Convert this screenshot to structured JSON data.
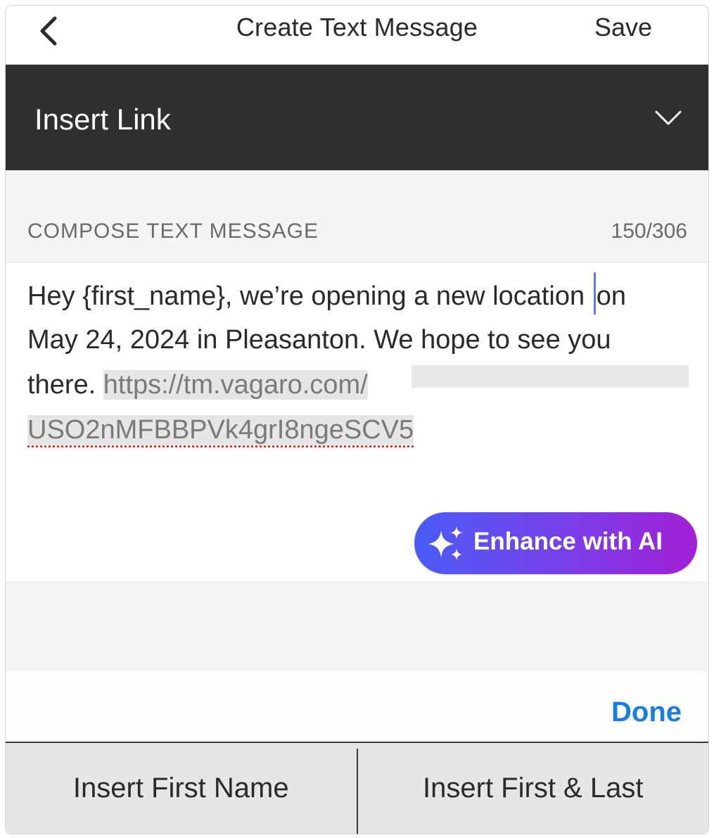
{
  "nav": {
    "title": "Create Text Message",
    "save_label": "Save",
    "back_icon": "chevron-left-icon"
  },
  "insert_link": {
    "label": "Insert Link",
    "icon": "chevron-down-icon"
  },
  "compose": {
    "label": "COMPOSE TEXT MESSAGE",
    "char_count": "150/306",
    "message": {
      "line1_before_caret": "Hey {first_name}, we’re opening a new location ",
      "line1_after_caret": "on",
      "line2": "May 24, 2024 in Pleasanton. We hope to see you",
      "line3_text": "there. ",
      "line3_link": "https://tm.vagaro.com/",
      "line4_link": "USO2nMFBBPVk4grI8ngeSCV5"
    },
    "ai_button_label": "Enhance with AI",
    "ai_icon": "sparkles-icon"
  },
  "keyboard_accessory": {
    "done_label": "Done"
  },
  "toolbar": {
    "insert_first_name": "Insert First Name",
    "insert_first_last": "Insert First & Last"
  },
  "colors": {
    "header_dark": "#2f2f2f",
    "done_blue": "#1a7ee0",
    "ai_gradient_start": "#4a5cf6",
    "ai_gradient_end": "#a21fd6",
    "spellcheck_red": "#e8302f"
  }
}
